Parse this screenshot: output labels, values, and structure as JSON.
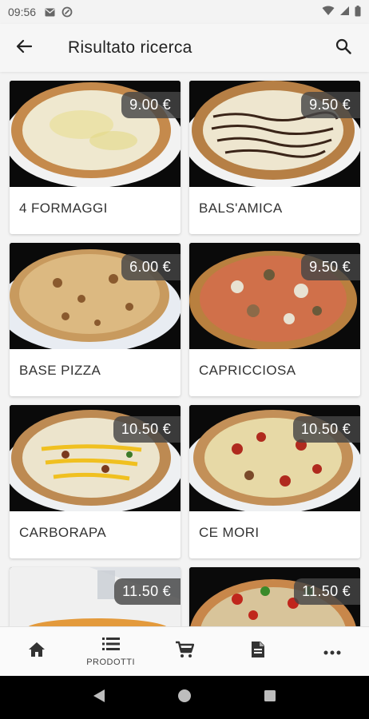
{
  "status_bar": {
    "time": "09:56"
  },
  "app_bar": {
    "title": "Risultato ricerca"
  },
  "products": [
    {
      "name": "4 FORMAGGI",
      "price": "9.00 €"
    },
    {
      "name": "BALS'AMICA",
      "price": "9.50 €"
    },
    {
      "name": "BASE PIZZA",
      "price": "6.00 €"
    },
    {
      "name": "CAPRICCIOSA",
      "price": "9.50 €"
    },
    {
      "name": "CARBORAPA",
      "price": "10.50 €"
    },
    {
      "name": "CE MORI",
      "price": "10.50 €"
    },
    {
      "name": "",
      "price": "11.50 €"
    },
    {
      "name": "",
      "price": "11.50 €"
    }
  ],
  "bottom_nav": {
    "items": [
      {
        "icon": "home-icon",
        "label": ""
      },
      {
        "icon": "list-icon",
        "label": "PRODOTTI"
      },
      {
        "icon": "cart-icon",
        "label": ""
      },
      {
        "icon": "document-icon",
        "label": ""
      },
      {
        "icon": "more-icon",
        "label": ""
      }
    ]
  },
  "colors": {
    "background": "#f3f3f3",
    "card": "#ffffff",
    "price_badge": "#464646",
    "sysnav": "#000000"
  }
}
